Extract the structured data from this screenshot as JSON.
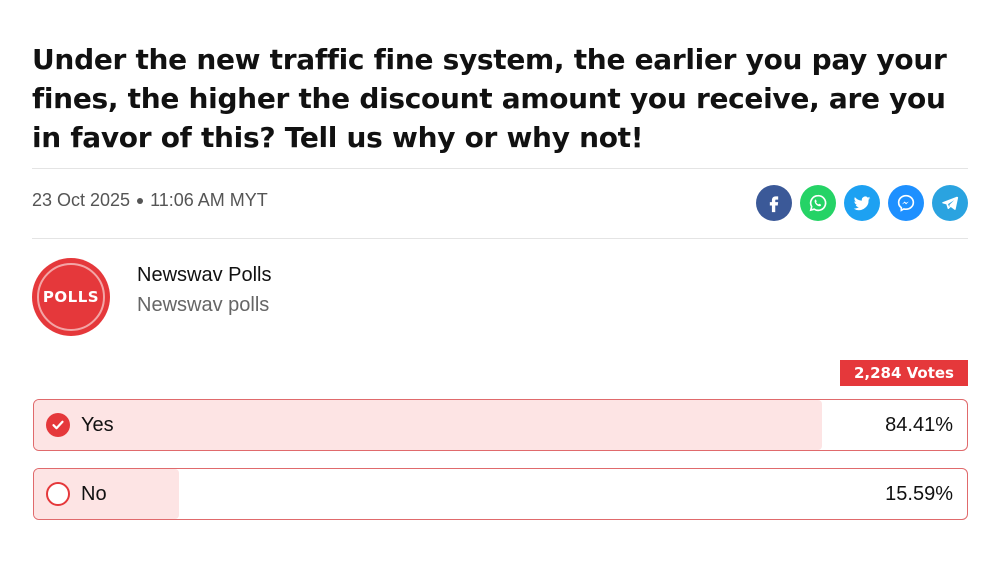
{
  "headline": "Under the new traffic fine system, the earlier you pay your fines, the higher the discount amount you receive, are you in favor of this? Tell us why or why not!",
  "meta": {
    "date": "23 Oct 2025",
    "time": "11:06 AM MYT"
  },
  "share_buttons": [
    {
      "name": "facebook",
      "icon": "facebook-icon",
      "color": "#3b5998"
    },
    {
      "name": "whatsapp",
      "icon": "whatsapp-icon",
      "color": "#25d366"
    },
    {
      "name": "twitter",
      "icon": "twitter-icon",
      "color": "#1da1f2"
    },
    {
      "name": "messenger",
      "icon": "messenger-icon",
      "color": "#1e90ff"
    },
    {
      "name": "telegram",
      "icon": "telegram-icon",
      "color": "#2aa3e0"
    }
  ],
  "author": {
    "avatar_text": "POLLS",
    "name": "Newswav Polls",
    "handle": "Newswav polls"
  },
  "poll": {
    "votes_label": "2,284 Votes",
    "accent_color": "#e5383b",
    "options": [
      {
        "label": "Yes",
        "percent_label": "84.41%",
        "percent": 84.41,
        "selected": true
      },
      {
        "label": "No",
        "percent_label": "15.59%",
        "percent": 15.59,
        "selected": false
      }
    ]
  }
}
